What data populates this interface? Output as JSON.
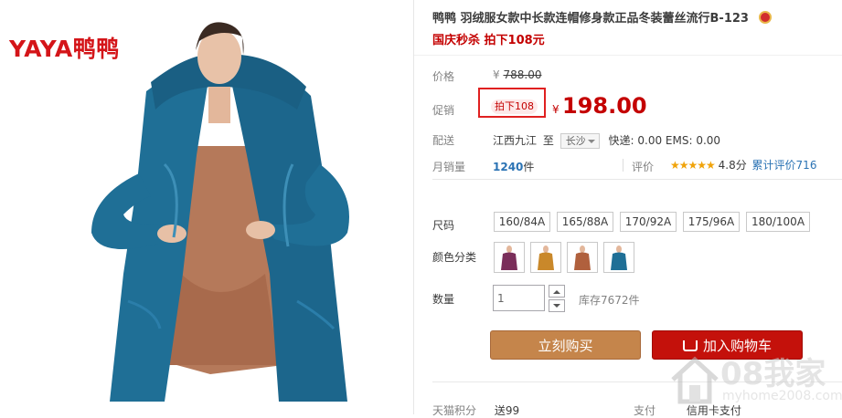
{
  "brand": {
    "logo_text": "YAYA鸭鸭"
  },
  "product": {
    "title": "鸭鸭 羽绒服女款中长款连帽修身款正品冬装蕾丝流行B-123",
    "promo_line": "国庆秒杀 拍下108元"
  },
  "price": {
    "label": "价格",
    "currency": "¥",
    "original": "788.00"
  },
  "promotion": {
    "label": "促销",
    "tag": "拍下108",
    "currency": "¥",
    "price": "198.00"
  },
  "shipping": {
    "label": "配送",
    "from": "江西九江",
    "to_word": "至",
    "destination": "长沙",
    "fees": "快递: 0.00 EMS: 0.00"
  },
  "sales": {
    "label": "月销量",
    "count": "1240",
    "unit": "件",
    "rating_label": "评价",
    "stars": "★★★★★",
    "score": "4.8分",
    "reviews": "累计评价716"
  },
  "sizes": {
    "label": "尺码",
    "options": [
      "160/84A",
      "165/88A",
      "170/92A",
      "175/96A",
      "180/100A"
    ]
  },
  "colors": {
    "label": "颜色分类",
    "swatch_colors": [
      "#7a2e5a",
      "#c9882a",
      "#b0603d",
      "#1f6f96"
    ]
  },
  "quantity": {
    "label": "数量",
    "value": "1",
    "stock": "库存7672件"
  },
  "actions": {
    "buy_now": "立刻购买",
    "add_to_cart": "加入购物车"
  },
  "footer": {
    "points_label": "天猫积分",
    "points_value": "送99",
    "pay_label": "支付",
    "pay_value": "信用卡支付"
  },
  "watermark": {
    "text_main": "08我家",
    "text_sub": "myhome2008.com"
  },
  "theme": {
    "accent_red": "#c40000",
    "buy_color": "#c5854b",
    "cart_color": "#c4110b",
    "coat_color": "#1f6f96"
  }
}
